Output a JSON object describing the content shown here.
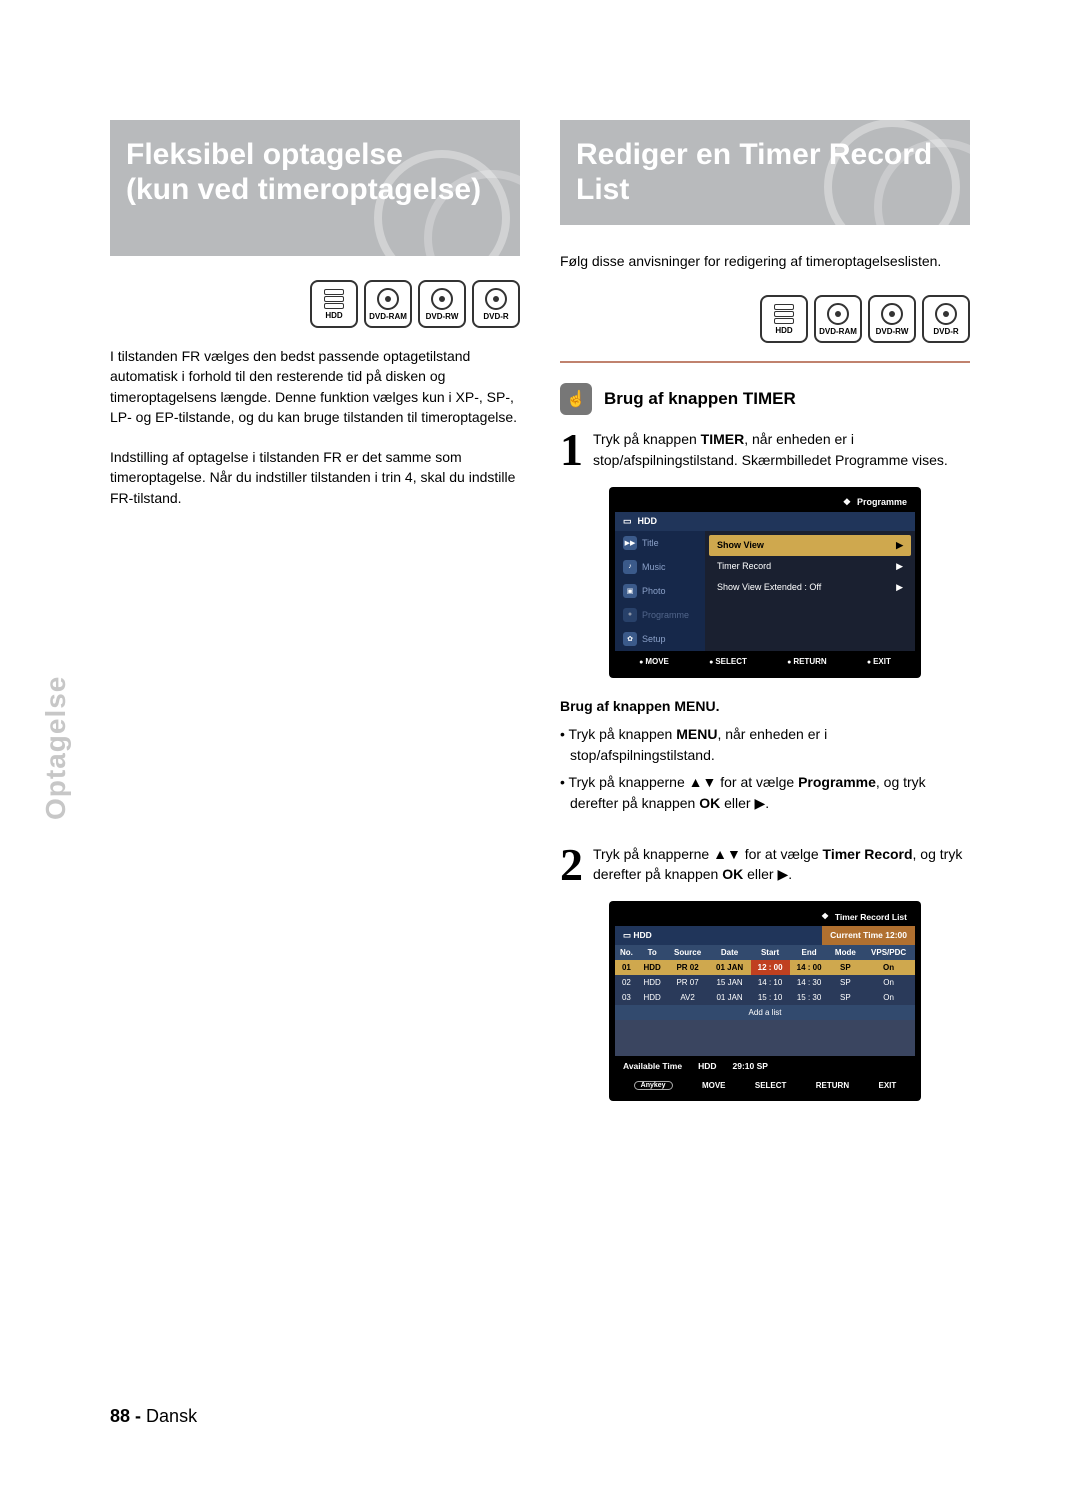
{
  "left": {
    "title_line1": "Fleksibel optagelse",
    "title_line2": "(kun ved timeroptagelse)",
    "formats": [
      "HDD",
      "DVD-RAM",
      "DVD-RW",
      "DVD-R"
    ],
    "para1": "I tilstanden FR vælges den bedst passende optagetilstand automatisk i forhold til den resterende tid på disken og timeroptagelsens længde. Denne funktion vælges kun i XP-, SP-, LP- og EP-tilstande, og du kan bruge tilstanden til timeroptagelse.",
    "para2": "Indstilling af optagelse i tilstanden FR er det samme som timeroptagelse. Når du indstiller tilstanden i trin 4, skal du indstille FR-tilstand."
  },
  "right": {
    "title": "Rediger en Timer Record List",
    "intro": "Følg disse anvisninger for redigering af timeroptagelseslisten.",
    "formats": [
      "HDD",
      "DVD-RAM",
      "DVD-RW",
      "DVD-R"
    ],
    "subhead": "Brug af knappen TIMER",
    "step1_a": "Tryk på knappen ",
    "step1_b": "TIMER",
    "step1_c": ", når enheden er i stop/afspilningstilstand. Skærmbilledet Programme vises.",
    "menu_head": "Brug af knappen MENU.",
    "bullet1_a": "Tryk på knappen ",
    "bullet1_b": "MENU",
    "bullet1_c": ", når enheden er i stop/afspilningstilstand.",
    "bullet2_a": "Tryk på knapperne ▲▼ for at vælge ",
    "bullet2_b": "Programme",
    "bullet2_c": ", og tryk derefter på knappen ",
    "bullet2_d": "OK",
    "bullet2_e": " eller ▶.",
    "step2_a": "Tryk på knapperne ▲▼ for at vælge ",
    "step2_b": "Timer Record",
    "step2_c": ", og tryk derefter på knappen ",
    "step2_d": "OK",
    "step2_e": " eller ▶."
  },
  "osd1": {
    "header_icon": "❖",
    "header": "Programme",
    "hdd": "HDD",
    "left_items": [
      {
        "ico": "▶▶",
        "label": "Title"
      },
      {
        "ico": "♪",
        "label": "Music"
      },
      {
        "ico": "▣",
        "label": "Photo"
      },
      {
        "ico": "●",
        "label": "Programme"
      },
      {
        "ico": "✿",
        "label": "Setup"
      }
    ],
    "right_items": [
      {
        "label": "Show View",
        "sel": true
      },
      {
        "label": "Timer Record",
        "sel": false
      },
      {
        "label": "Show View Extended  : Off",
        "sel": false
      }
    ],
    "footer": [
      "MOVE",
      "SELECT",
      "RETURN",
      "EXIT"
    ]
  },
  "osd2": {
    "header_icon": "❖",
    "header": "Timer Record List",
    "hdd": "HDD",
    "current_time_label": "Current Time",
    "current_time": "12:00",
    "cols": [
      "No.",
      "To",
      "Source",
      "Date",
      "Start",
      "End",
      "Mode",
      "VPS/PDC"
    ],
    "rows": [
      {
        "no": "01",
        "to": "HDD",
        "src": "PR 02",
        "date": "01 JAN",
        "start": "12 : 00",
        "end": "14 : 00",
        "mode": "SP",
        "vps": "On",
        "hl": true
      },
      {
        "no": "02",
        "to": "HDD",
        "src": "PR 07",
        "date": "15 JAN",
        "start": "14 : 10",
        "end": "14 : 30",
        "mode": "SP",
        "vps": "On"
      },
      {
        "no": "03",
        "to": "HDD",
        "src": "AV2",
        "date": "01 JAN",
        "start": "15 : 10",
        "end": "15 : 30",
        "mode": "SP",
        "vps": "On"
      }
    ],
    "add": "Add a list",
    "avail_label": "Available Time",
    "avail_to": "HDD",
    "avail_val": "29:10  SP",
    "anykey": "Anykey",
    "footer": [
      "MOVE",
      "SELECT",
      "RETURN",
      "EXIT"
    ]
  },
  "side_label": "Optagelse",
  "footer_page": "88 -",
  "footer_lang": "Dansk"
}
